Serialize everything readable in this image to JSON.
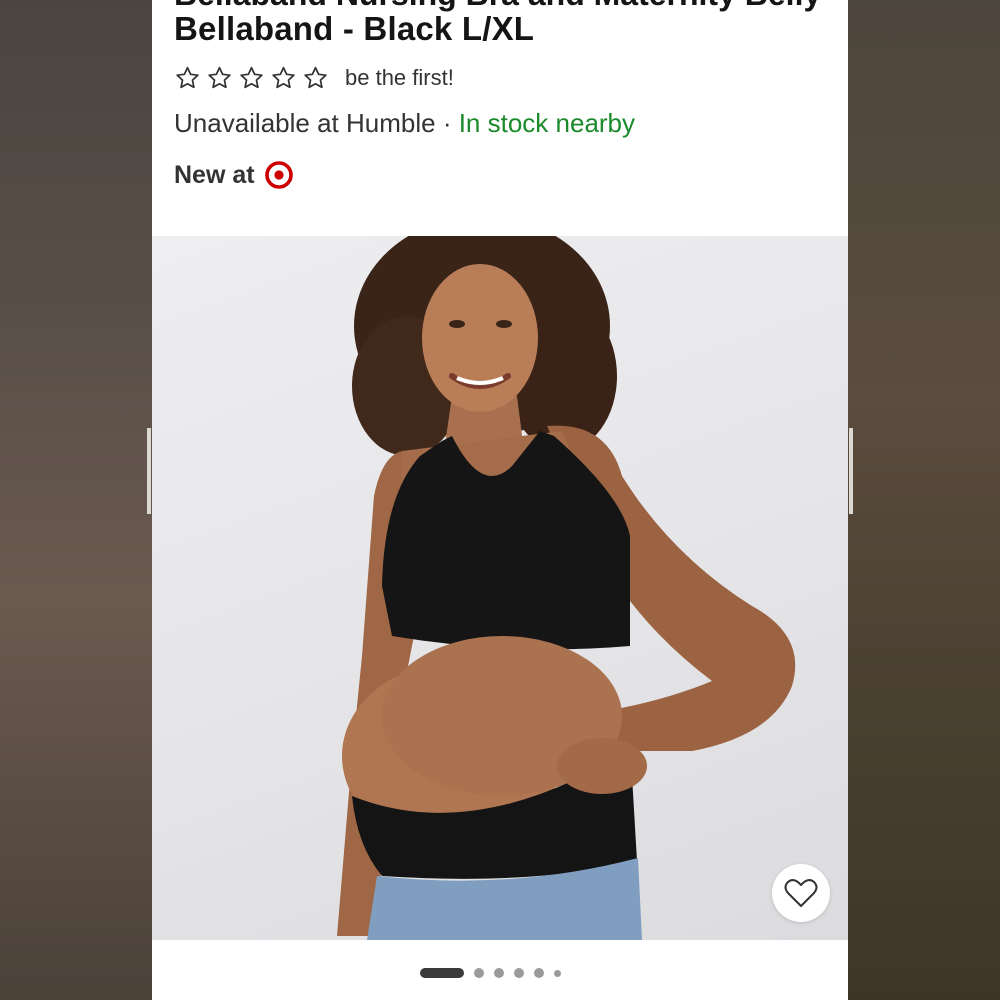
{
  "product": {
    "title_partial": "Bellaband Nursing Bra and Maternity Belly",
    "title": "Bellaband - Black L/XL",
    "rating_text": "be the first!",
    "availability": {
      "store_status": "Unavailable at Humble",
      "separator": " · ",
      "nearby_status": "In stock nearby"
    },
    "new_at_label": "New at"
  },
  "rating": {
    "stars_total": 5,
    "stars_filled": 0
  },
  "gallery": {
    "image_count": 6,
    "active_index": 0
  },
  "colors": {
    "accent_red": "#cc0000",
    "stock_green": "#1a8a2a"
  },
  "icons": [
    "star-outline-icon",
    "target-bullseye-icon",
    "heart-outline-icon"
  ]
}
